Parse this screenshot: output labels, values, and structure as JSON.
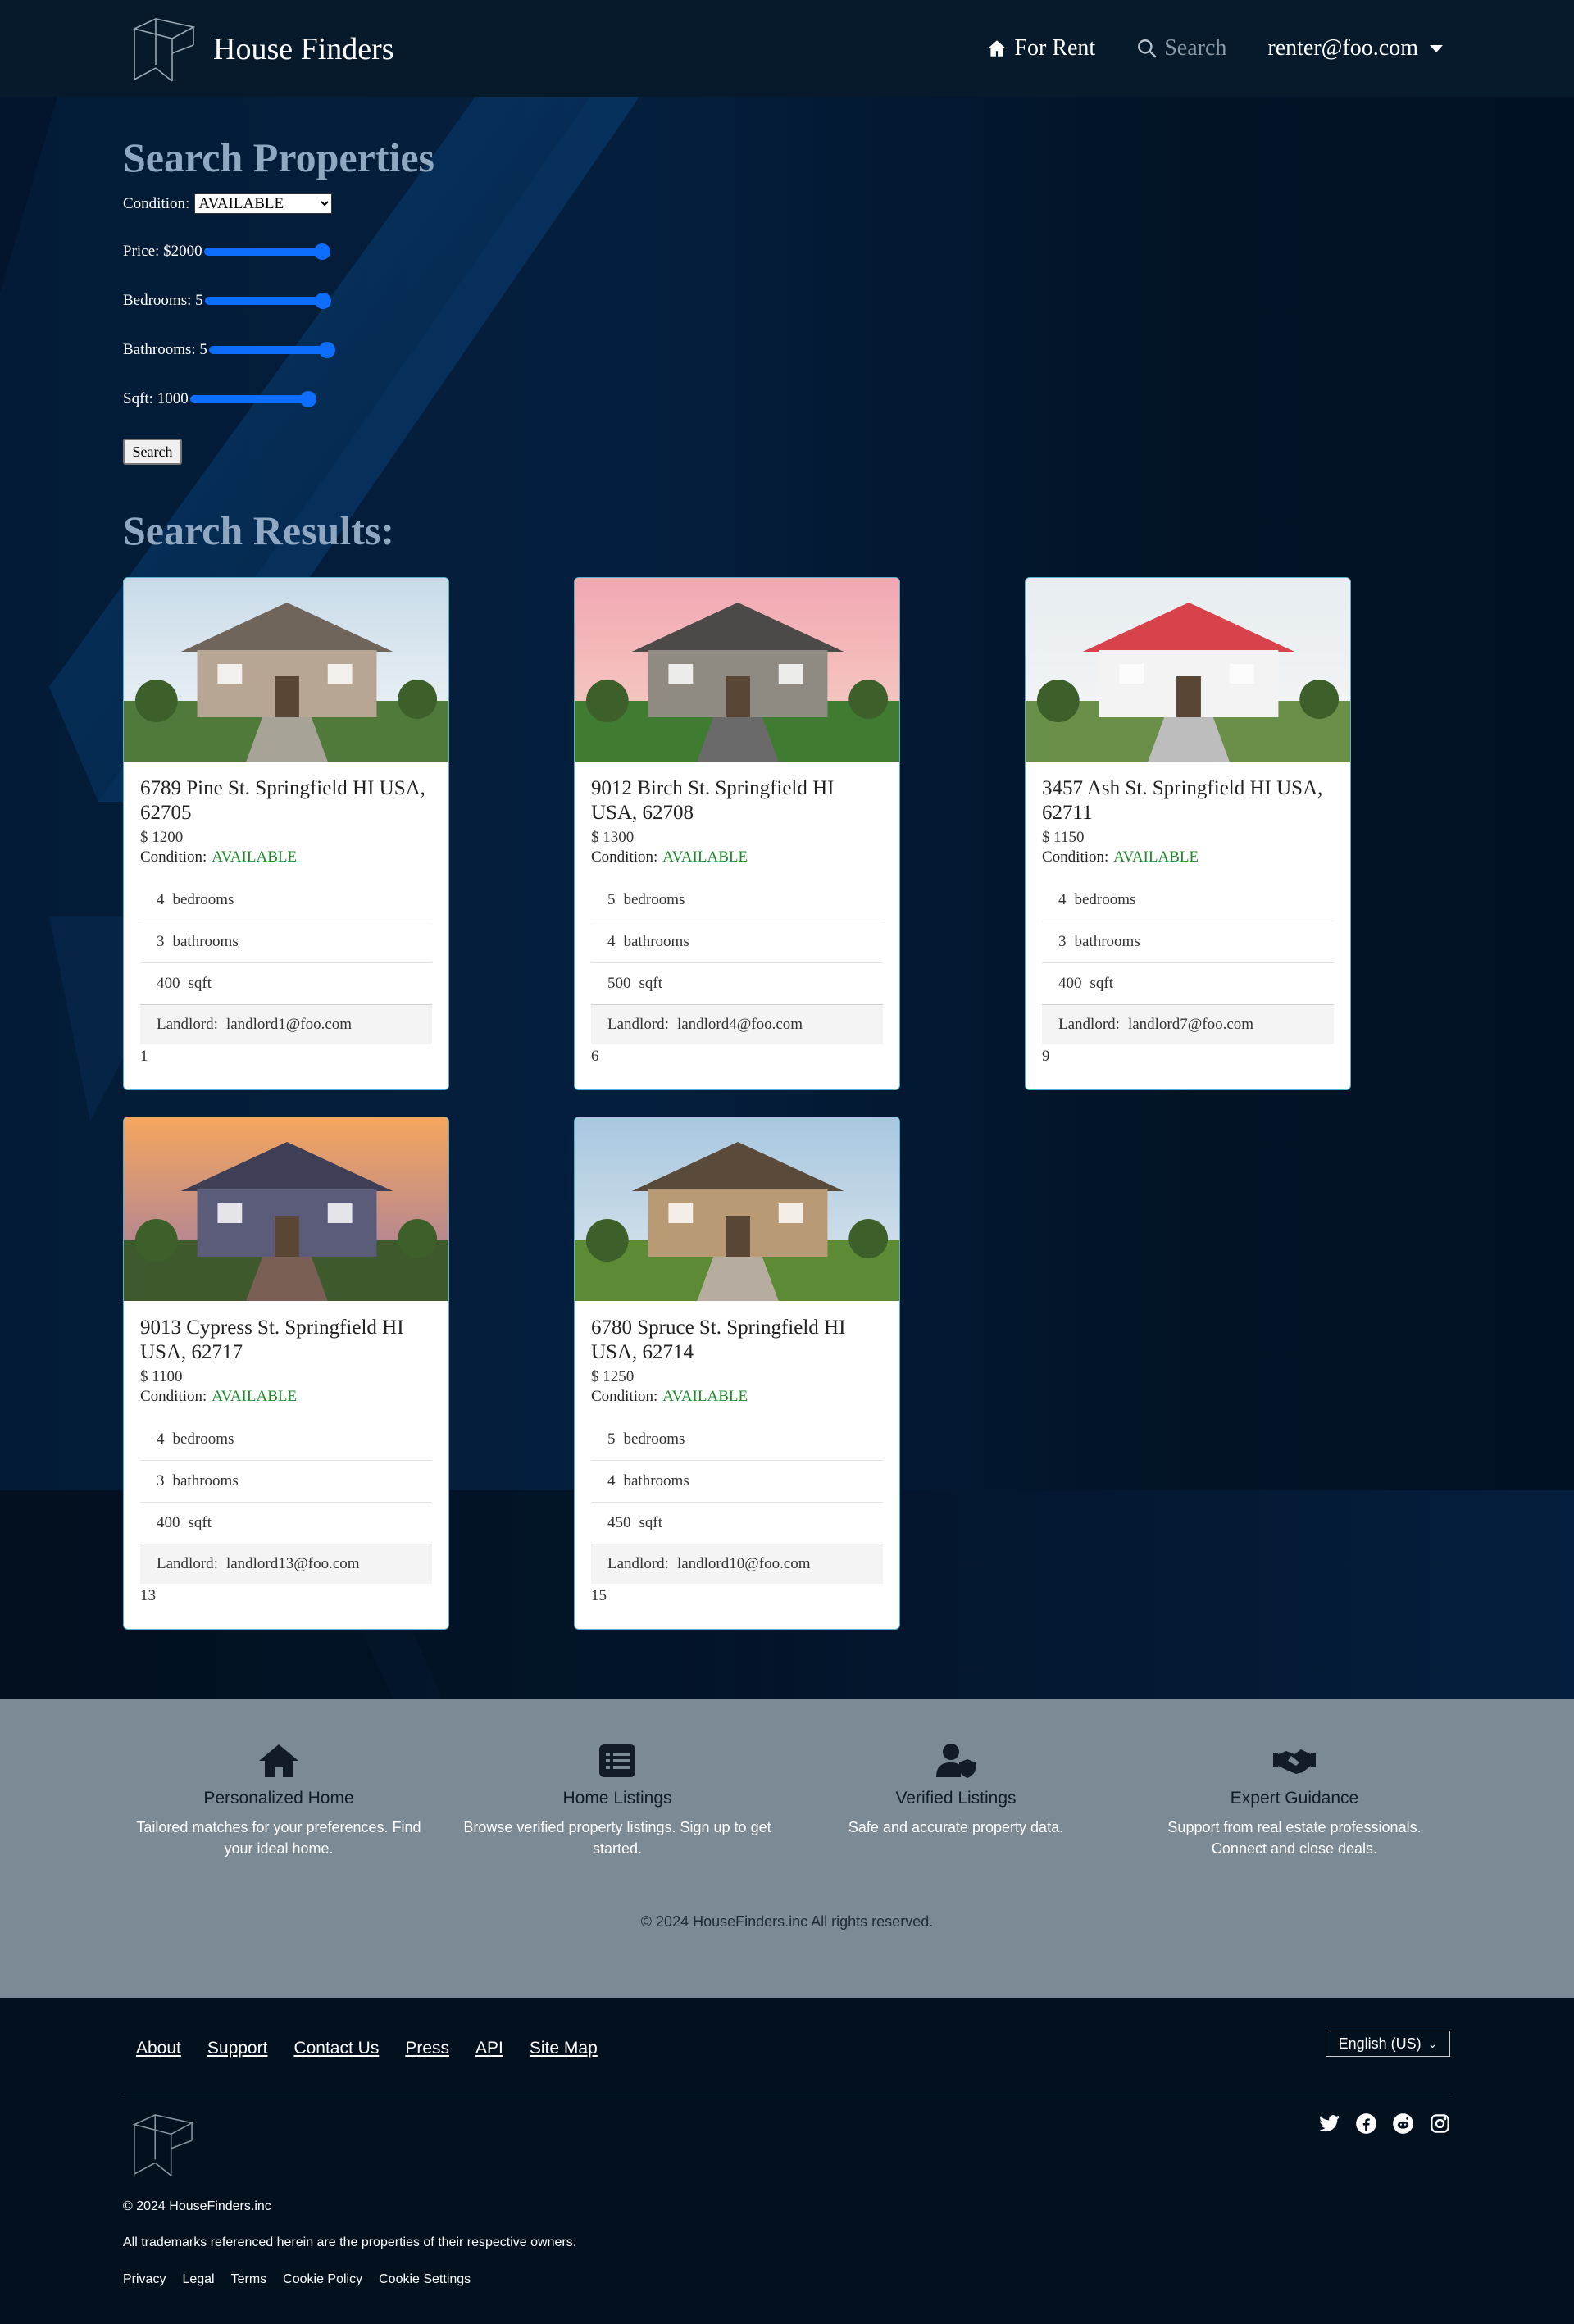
{
  "nav": {
    "brand": "House Finders",
    "for_rent": "For Rent",
    "search": "Search",
    "user": "renter@foo.com"
  },
  "search_form": {
    "title": "Search Properties",
    "condition_label": "Condition:",
    "condition_value": "AVAILABLE",
    "price_label": "Price: $2000",
    "bedrooms_label": "Bedrooms: 5",
    "bathrooms_label": "Bathrooms: 5",
    "sqft_label": "Sqft: 1000",
    "search_button": "Search"
  },
  "results": {
    "title": "Search Results:",
    "condition_label": "Condition:",
    "landlord_label": "Landlord:",
    "bedrooms_unit": "bedrooms",
    "bathrooms_unit": "bathrooms",
    "sqft_unit": "sqft",
    "cards": [
      {
        "address": "6789 Pine St. Springfield HI USA, 62705",
        "price": "$ 1200",
        "condition": "AVAILABLE",
        "bedrooms": "4",
        "bathrooms": "3",
        "sqft": "400",
        "landlord": "landlord1@foo.com",
        "id": "1"
      },
      {
        "address": "9012 Birch St. Springfield HI USA, 62708",
        "price": "$ 1300",
        "condition": "AVAILABLE",
        "bedrooms": "5",
        "bathrooms": "4",
        "sqft": "500",
        "landlord": "landlord4@foo.com",
        "id": "6"
      },
      {
        "address": "3457 Ash St. Springfield HI USA, 62711",
        "price": "$ 1150",
        "condition": "AVAILABLE",
        "bedrooms": "4",
        "bathrooms": "3",
        "sqft": "400",
        "landlord": "landlord7@foo.com",
        "id": "9"
      },
      {
        "address": "9013 Cypress St. Springfield HI USA, 62717",
        "price": "$ 1100",
        "condition": "AVAILABLE",
        "bedrooms": "4",
        "bathrooms": "3",
        "sqft": "400",
        "landlord": "landlord13@foo.com",
        "id": "13"
      },
      {
        "address": "6780 Spruce St. Springfield HI USA, 62714",
        "price": "$ 1250",
        "condition": "AVAILABLE",
        "bedrooms": "5",
        "bathrooms": "4",
        "sqft": "450",
        "landlord": "landlord10@foo.com",
        "id": "15"
      }
    ]
  },
  "features": [
    {
      "icon": "house-icon",
      "title": "Personalized Home",
      "desc": "Tailored matches for your preferences. Find your ideal home."
    },
    {
      "icon": "list-icon",
      "title": "Home Listings",
      "desc": "Browse verified property listings. Sign up to get started."
    },
    {
      "icon": "user-shield-icon",
      "title": "Verified Listings",
      "desc": "Safe and accurate property data."
    },
    {
      "icon": "handshake-icon",
      "title": "Expert Guidance",
      "desc": "Support from real estate professionals. Connect and close deals."
    }
  ],
  "copyright_center": "© 2024 HouseFinders.inc All rights reserved.",
  "footer": {
    "links": [
      "About",
      "Support",
      "Contact Us",
      "Press",
      "API",
      "Site Map"
    ],
    "language": "English (US)",
    "copyright": "© 2024 HouseFinders.inc",
    "trademark": "All trademarks referenced herein are the properties of their respective owners.",
    "legal": [
      "Privacy",
      "Legal",
      "Terms",
      "Cookie Policy",
      "Cookie Settings"
    ]
  },
  "colors": {
    "navbar": "#061a2b",
    "accent": "#0d6efd",
    "available": "#1d8a2b",
    "features_bg": "#7c8a96",
    "footer_bg": "#03111f"
  }
}
